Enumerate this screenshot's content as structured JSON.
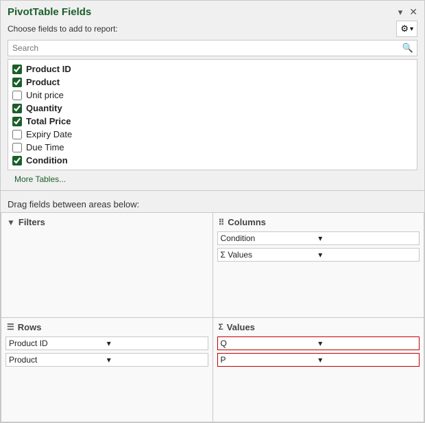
{
  "panel": {
    "title": "PivotTable Fields",
    "subtitle": "Choose fields to add to report:",
    "search_placeholder": "Search",
    "more_tables": "More Tables...",
    "drag_label": "Drag fields between areas below:"
  },
  "fields": [
    {
      "id": "product-id",
      "label": "Product ID",
      "checked": true,
      "bold": true
    },
    {
      "id": "product",
      "label": "Product",
      "checked": true,
      "bold": true
    },
    {
      "id": "unit-price",
      "label": "Unit price",
      "checked": false,
      "bold": false
    },
    {
      "id": "quantity",
      "label": "Quantity",
      "checked": true,
      "bold": true
    },
    {
      "id": "total-price",
      "label": "Total Price",
      "checked": true,
      "bold": true
    },
    {
      "id": "expiry-date",
      "label": "Expiry Date",
      "checked": false,
      "bold": false
    },
    {
      "id": "due-time",
      "label": "Due Time",
      "checked": false,
      "bold": false
    },
    {
      "id": "condition",
      "label": "Condition",
      "checked": true,
      "bold": true
    }
  ],
  "areas": {
    "filters": {
      "label": "Filters",
      "icon": "▼",
      "items": []
    },
    "columns": {
      "label": "Columns",
      "icon": "|||",
      "items": [
        {
          "label": "Condition"
        },
        {
          "label": "Σ Values"
        }
      ]
    },
    "rows": {
      "label": "Rows",
      "icon": "≡",
      "items": [
        {
          "label": "Product ID"
        },
        {
          "label": "Product"
        }
      ]
    },
    "values": {
      "label": "Values",
      "icon": "Σ",
      "items": [
        {
          "label": "Q",
          "highlighted": true
        },
        {
          "label": "P",
          "highlighted": true
        }
      ]
    }
  },
  "icons": {
    "settings": "⚙",
    "chevron_down": "▾",
    "close": "✕",
    "search": "🔍",
    "filter": "▼",
    "columns": "⠿",
    "rows": "☰",
    "sigma": "Σ"
  }
}
